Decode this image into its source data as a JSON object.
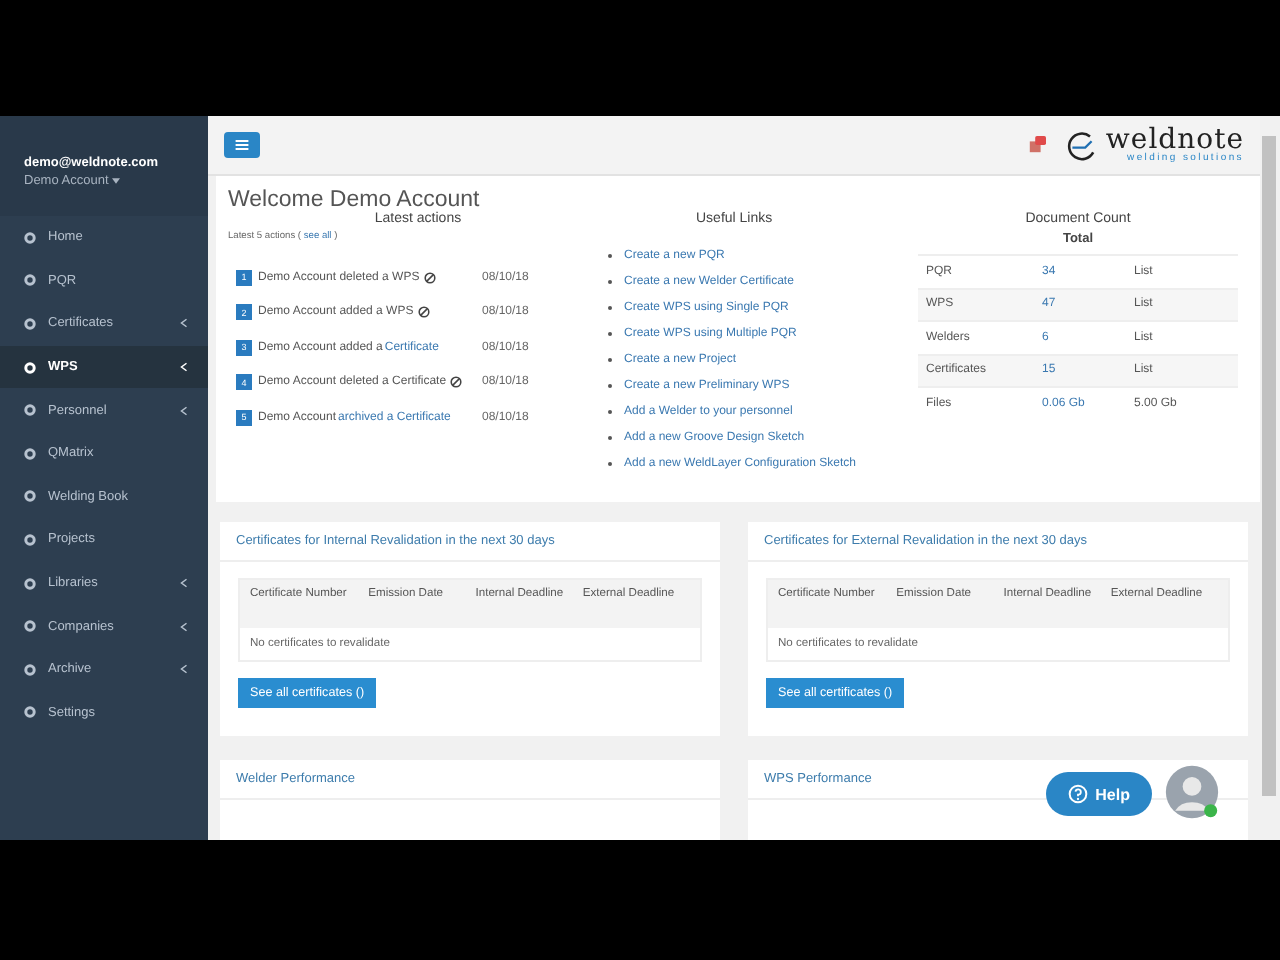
{
  "sidebar": {
    "email": "demo@weldnote.com",
    "account": "Demo Account",
    "items": [
      {
        "label": "Home",
        "selected": false,
        "expandable": false
      },
      {
        "label": "PQR",
        "selected": false,
        "expandable": false
      },
      {
        "label": "Certificates",
        "selected": false,
        "expandable": true
      },
      {
        "label": "WPS",
        "selected": true,
        "expandable": true
      },
      {
        "label": "Personnel",
        "selected": false,
        "expandable": true
      },
      {
        "label": "QMatrix",
        "selected": false,
        "expandable": false
      },
      {
        "label": "Welding Book",
        "selected": false,
        "expandable": false
      },
      {
        "label": "Projects",
        "selected": false,
        "expandable": false
      },
      {
        "label": "Libraries",
        "selected": false,
        "expandable": true
      },
      {
        "label": "Companies",
        "selected": false,
        "expandable": true
      },
      {
        "label": "Archive",
        "selected": false,
        "expandable": true
      },
      {
        "label": "Settings",
        "selected": false,
        "expandable": false
      }
    ]
  },
  "logo": {
    "name": "weldnote",
    "tagline": "welding solutions"
  },
  "welcome": "Welcome Demo Account",
  "latest_actions": {
    "title": "Latest actions",
    "subtitle": "Latest 5 actions (",
    "see_all": "see all",
    "subtitle_end": ")",
    "items": [
      {
        "number": "1",
        "text": "Demo Account deleted a WPS",
        "deleted": true,
        "date": "08/10/18"
      },
      {
        "number": "2",
        "text": "Demo Account added a WPS",
        "deleted": true,
        "date": "08/10/18"
      },
      {
        "number": "3",
        "text": "Demo Account added a",
        "link": "Certificate",
        "deleted": false,
        "date": "08/10/18"
      },
      {
        "number": "4",
        "text": "Demo Account deleted a Certificate",
        "deleted": true,
        "date": "08/10/18"
      },
      {
        "number": "5",
        "text": "Demo Account",
        "link": "archived a Certificate",
        "deleted": false,
        "date": "08/10/18"
      }
    ]
  },
  "useful_links": {
    "title": "Useful Links",
    "items": [
      "Create a new PQR",
      "Create a new Welder Certificate",
      "Create WPS using Single PQR",
      "Create WPS using Multiple PQR",
      "Create a new Project",
      "Create a new Preliminary WPS",
      "Add a Welder to your personnel",
      "Add a new Groove Design Sketch",
      "Add a new WeldLayer Configuration Sketch"
    ]
  },
  "document_count": {
    "title": "Document Count",
    "column": "Total",
    "rows": [
      {
        "label": "PQR",
        "count": "34",
        "extra": "List"
      },
      {
        "label": "WPS",
        "count": "47",
        "extra": "List"
      },
      {
        "label": "Welders",
        "count": "6",
        "extra": "List"
      },
      {
        "label": "Certificates",
        "count": "15",
        "extra": "List"
      },
      {
        "label": "Files",
        "count": "0.06 Gb",
        "extra": "5.00 Gb"
      }
    ]
  },
  "revalidation_cards": [
    {
      "title": "Certificates for Internal Revalidation in the next 30 days",
      "columns": [
        "Certificate Number",
        "Emission Date",
        "Internal Deadline",
        "External Deadline"
      ],
      "empty": "No certificates to revalidate",
      "button": "See all certificates ()"
    },
    {
      "title": "Certificates for External Revalidation in the next 30 days",
      "columns": [
        "Certificate Number",
        "Emission Date",
        "Internal Deadline",
        "External Deadline"
      ],
      "empty": "No certificates to revalidate",
      "button": "See all certificates ()"
    }
  ],
  "performance_cards": [
    "Welder Performance",
    "WPS Performance"
  ],
  "help_button": "Help"
}
